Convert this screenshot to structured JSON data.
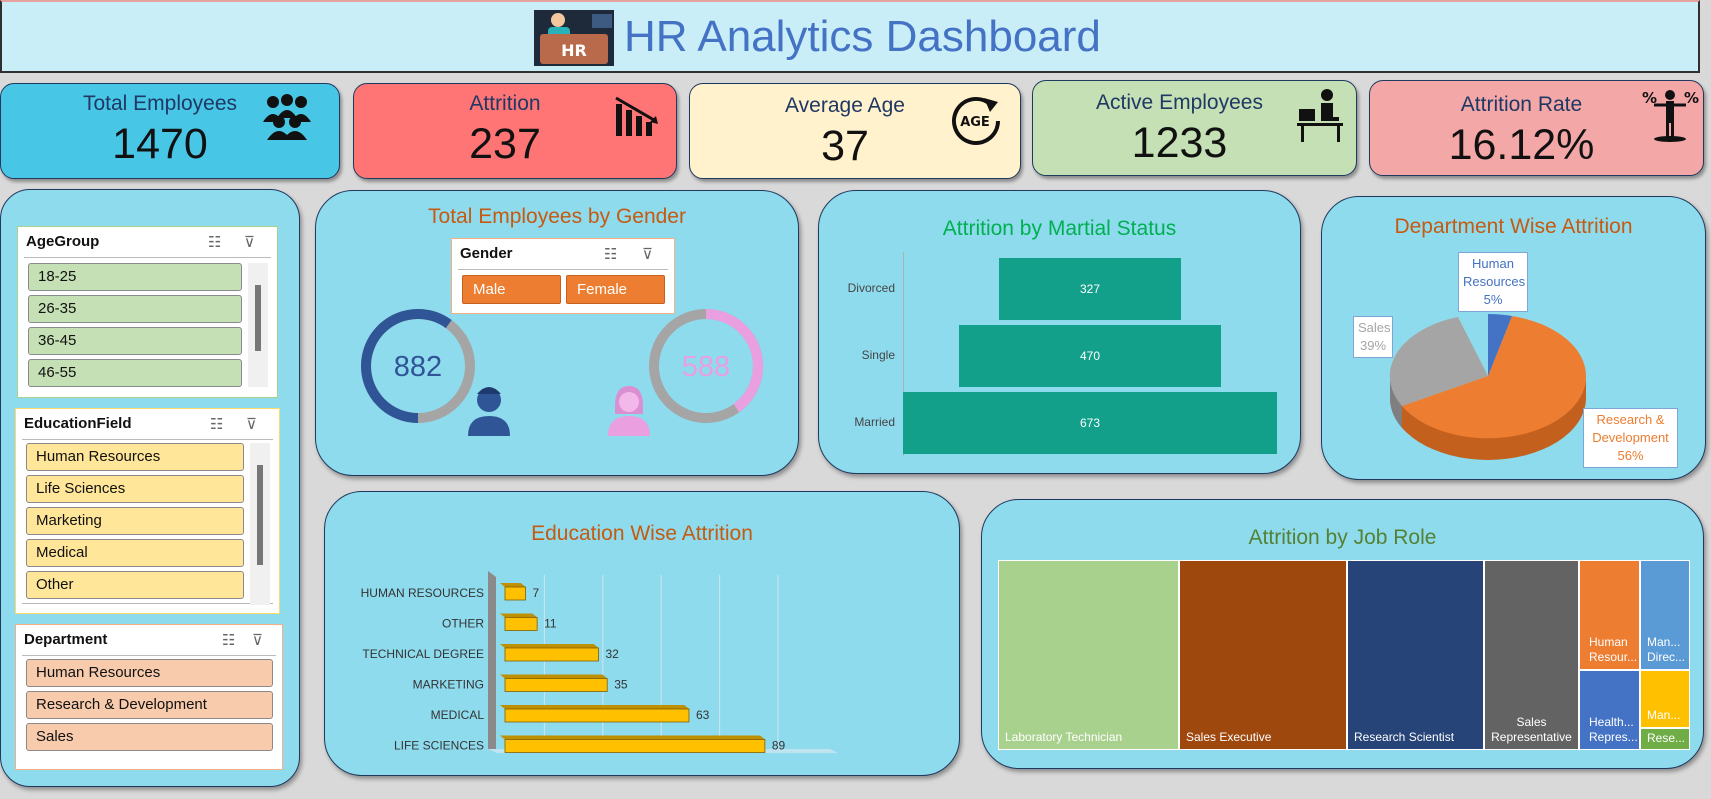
{
  "header": {
    "title": "HR Analytics Dashboard",
    "logo_text": "HR"
  },
  "kpis": [
    {
      "label": "Total Employees",
      "value": "1470",
      "icon": "people-group-icon",
      "color": "#47c6e6"
    },
    {
      "label": "Attrition",
      "value": "237",
      "icon": "declining-chart-icon",
      "color": "#ff7474"
    },
    {
      "label": "Average Age",
      "value": "37",
      "icon": "age-cycle-icon",
      "icon_text": "AGE",
      "color": "#fff2cc"
    },
    {
      "label": "Active Employees",
      "value": "1233",
      "icon": "employee-desk-icon",
      "color": "#c5e0b4"
    },
    {
      "label": "Attrition Rate",
      "value": "16.12%",
      "icon": "percent-balance-icon",
      "color": "#f4a7a7"
    }
  ],
  "slicers": {
    "age_group": {
      "title": "AgeGroup",
      "items": [
        "18-25",
        "26-35",
        "36-45",
        "46-55"
      ],
      "color": "#c5e0b4"
    },
    "education_field": {
      "title": "EducationField",
      "items": [
        "Human Resources",
        "Life Sciences",
        "Marketing",
        "Medical",
        "Other"
      ],
      "color": "#ffe699"
    },
    "department": {
      "title": "Department",
      "items": [
        "Human Resources",
        "Research & Development",
        "Sales"
      ],
      "color": "#f8cbad"
    },
    "gender": {
      "title": "Gender",
      "items": [
        "Male",
        "Female"
      ]
    }
  },
  "gender_panel": {
    "title": "Total Employees by Gender",
    "male": {
      "value": "882",
      "fraction": 0.6,
      "color": "#2f5597"
    },
    "female": {
      "value": "588",
      "fraction": 0.4,
      "color": "#eaa0e0"
    }
  },
  "chart_data": [
    {
      "type": "bar",
      "title": "Attrition by Martial Status",
      "categories": [
        "Divorced",
        "Single",
        "Married"
      ],
      "values": [
        327,
        470,
        673
      ],
      "color": "#12a08a"
    },
    {
      "type": "pie",
      "title": "Department Wise Attrition",
      "categories": [
        "Human Resources",
        "Research & Development",
        "Sales"
      ],
      "values": [
        5,
        56,
        39
      ],
      "labels": [
        "5%",
        "56%",
        "39%"
      ],
      "colors": [
        "#4472c4",
        "#ed7d31",
        "#a5a5a5"
      ]
    },
    {
      "type": "bar",
      "title": "Education Wise Attrition",
      "categories": [
        "HUMAN RESOURCES",
        "OTHER",
        "TECHNICAL DEGREE",
        "MARKETING",
        "MEDICAL",
        "LIFE SCIENCES"
      ],
      "values": [
        7,
        11,
        32,
        35,
        63,
        89
      ],
      "color": "#ffc000"
    },
    {
      "type": "treemap",
      "title": "Attrition by Job Role",
      "categories": [
        "Laboratory Technician",
        "Sales Executive",
        "Research Scientist",
        "Sales Representative",
        "Human Resour...",
        "Man... Direc...",
        "Health... Repres...",
        "Man...",
        "Rese..."
      ],
      "colors": [
        "#a9d18e",
        "#9e480e",
        "#264478",
        "#636363",
        "#ed7d31",
        "#5b9bd5",
        "#4472c4",
        "#ffc000",
        "#70ad47"
      ]
    }
  ]
}
